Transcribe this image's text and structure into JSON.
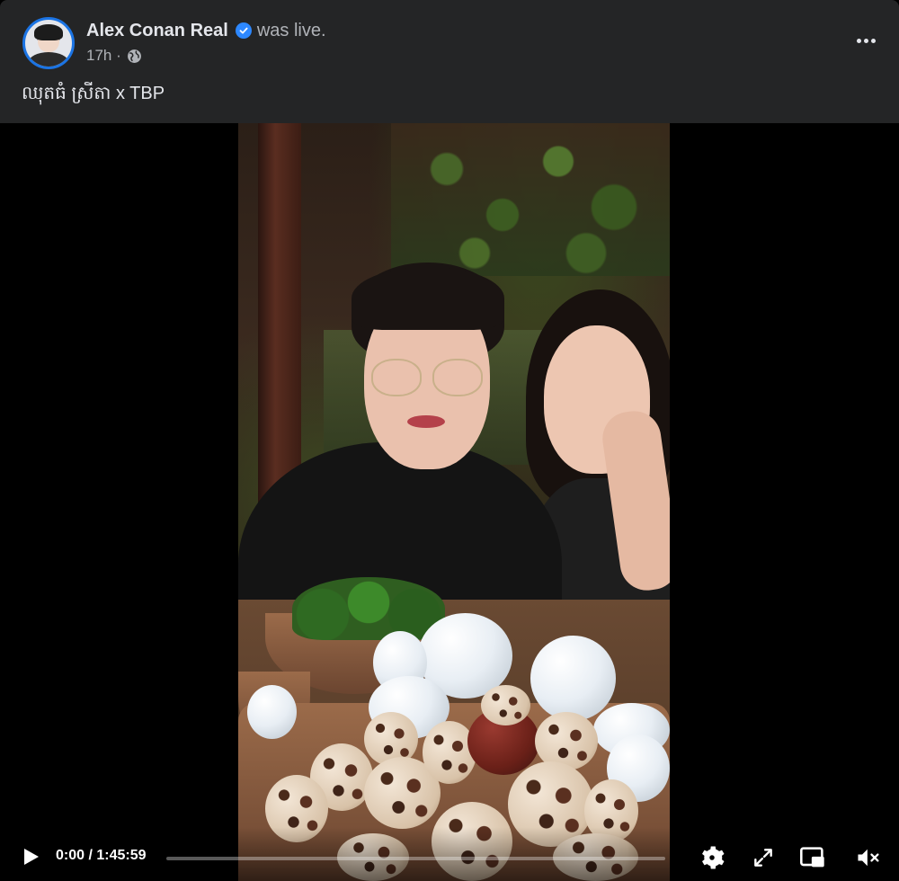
{
  "post": {
    "author": "Alex Conan Real",
    "status": "was live.",
    "time": "17h ·",
    "caption": "ឈុតធំ ស្រីតា x TBP",
    "icons": {
      "verified": "verified-badge-icon",
      "privacy": "globe-icon",
      "more": "more-options-icon"
    }
  },
  "player": {
    "current_time": "0:00",
    "separator": " / ",
    "duration": "1:45:59",
    "progress": 0.0,
    "icons": [
      "play-icon",
      "settings-icon",
      "fullscreen-icon",
      "picture-in-picture-icon",
      "mute-icon"
    ]
  },
  "colors": {
    "header_bg": "#242526",
    "text_primary": "#e4e6eb",
    "text_secondary": "#b0b3b8",
    "verified": "#2d88ff"
  }
}
